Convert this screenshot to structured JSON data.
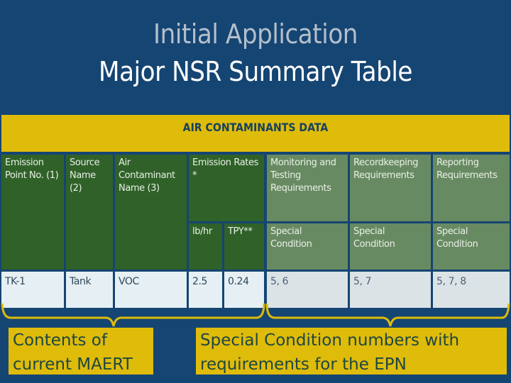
{
  "title": {
    "line1": "Initial Application",
    "line2": "Major NSR Summary Table"
  },
  "banner": "AIR CONTAMINANTS DATA",
  "table": {
    "headers": {
      "emission_point": "Emission Point No. (1)",
      "source_name": "Source Name (2)",
      "contaminant_name": "Air Contaminant Name (3)",
      "emission_rates": "Emission Rates *",
      "monitoring": "Monitoring and Testing Requirements",
      "recordkeeping": "Recordkeeping Requirements",
      "reporting": "Reporting Requirements",
      "lb_hr": "lb/hr",
      "tpy": "TPY**",
      "special_condition_1": "Special Condition",
      "special_condition_2": "Special Condition",
      "special_condition_3": "Special Condition"
    },
    "rows": [
      {
        "emission_point": "TK-1",
        "source_name": "Tank",
        "contaminant": "VOC",
        "lb_hr": "2.5",
        "tpy": "0.24",
        "monitoring": "5, 6",
        "recordkeeping": "5, 7",
        "reporting": "5, 7, 8"
      }
    ]
  },
  "callouts": {
    "left": "Contents of current MAERT",
    "right": "Special Condition numbers with requirements for the EPN"
  },
  "colors": {
    "background": "#154572",
    "accent_gold": "#dfbb0a",
    "header_dark_green": "#306129",
    "header_light_green": "#688a62"
  }
}
